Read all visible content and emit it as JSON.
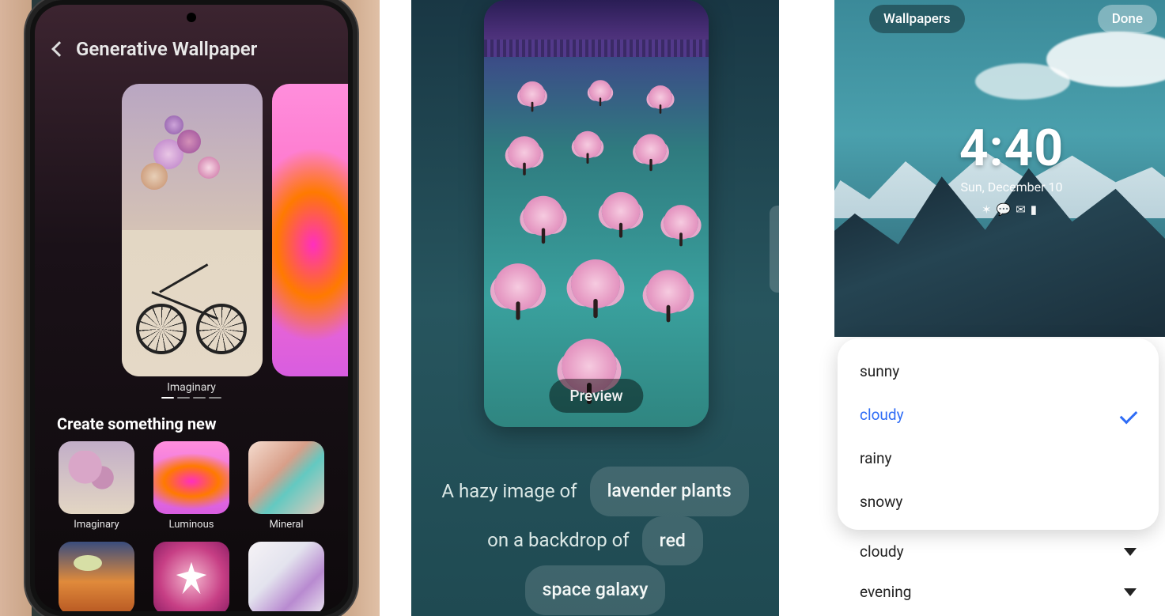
{
  "panel1": {
    "title": "Generative Wallpaper",
    "preview_caption": "Imaginary",
    "create_heading": "Create something new",
    "styles": [
      {
        "label": "Imaginary",
        "thumb": "imaginary"
      },
      {
        "label": "Luminous",
        "thumb": "luminous"
      },
      {
        "label": "Mineral",
        "thumb": "mineral"
      },
      {
        "label": "",
        "thumb": "desert"
      },
      {
        "label": "",
        "thumb": "insect"
      },
      {
        "label": "",
        "thumb": "smoke"
      }
    ]
  },
  "panel2": {
    "preview_button": "Preview",
    "prompt": {
      "line1_prefix": "A hazy image of",
      "chip1": "lavender plants",
      "line2_prefix": "on a backdrop of",
      "chip2": "red",
      "chip3": "space galaxy"
    }
  },
  "panel3": {
    "topbar": {
      "left": "Wallpapers",
      "right": "Done"
    },
    "clock": {
      "time": "4:40",
      "date": "Sun, December 10"
    },
    "status_icons": [
      "shuffle-icon",
      "chat-icon",
      "mail-icon",
      "battery-icon"
    ],
    "sheet_options": [
      {
        "label": "sunny",
        "selected": false
      },
      {
        "label": "cloudy",
        "selected": true
      },
      {
        "label": "rainy",
        "selected": false
      },
      {
        "label": "snowy",
        "selected": false
      }
    ],
    "below_selectors": [
      {
        "label": "cloudy"
      },
      {
        "label": "evening"
      }
    ]
  }
}
